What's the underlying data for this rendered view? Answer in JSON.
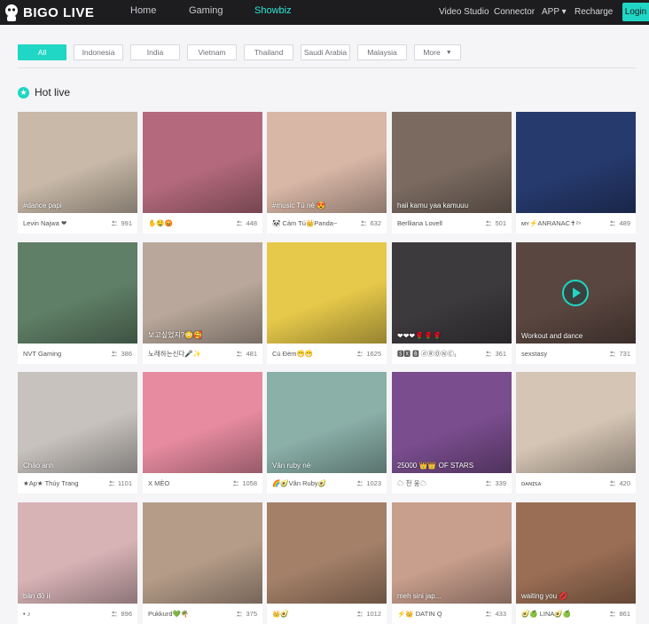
{
  "brand": {
    "name": "BIGO LIVE",
    "accent": "#20d6c4"
  },
  "nav": {
    "home": "Home",
    "gaming": "Gaming",
    "showbiz": "Showbiz",
    "video_studio": "Video Studio",
    "connector": "Connector",
    "app": "APP ▾",
    "recharge": "Recharge",
    "login": "Login"
  },
  "filters": [
    "All",
    "Indonesia",
    "India",
    "Vietnam",
    "Thailand",
    "Saudi Arabia",
    "Malaysia"
  ],
  "filters_more": "More",
  "section": {
    "title": "Hot live",
    "icon": "star-icon"
  },
  "cards": [
    {
      "label": "#dance papi",
      "name": "Levin Najwa ❤",
      "viewers": "991",
      "bg": "#c8b9a8"
    },
    {
      "label": "",
      "name": "✋🤤😡",
      "viewers": "448",
      "bg": "#b46a7c"
    },
    {
      "label": "#music Tú nè 😍",
      "name": "🐼 Cám Tú👑Panda~",
      "viewers": "632",
      "bg": "#d8b7a6"
    },
    {
      "label": "haii kamu yaa kamuuu",
      "name": "Berlliana Lovell",
      "viewers": "501",
      "bg": "#7a6a60"
    },
    {
      "label": "",
      "name": "ᴍʏ⚡ANRANAC✝⁲⁹",
      "viewers": "489",
      "bg": "#263a6e"
    },
    {
      "label": "",
      "name": "NVT Gaming",
      "viewers": "386",
      "bg": "#5f7f66"
    },
    {
      "label": "보고싶었지?😳🥰",
      "name": "노래하는신다🎤✨",
      "viewers": "481",
      "bg": "#b8a79a"
    },
    {
      "label": "",
      "name": "Cù Đèm😁😁",
      "viewers": "1625",
      "bg": "#e6c94a"
    },
    {
      "label": "❤❤❤🌹🌹🌹",
      "name": "🆂🆇 🅱 ⓓⓇⓄⓃⒸ₁",
      "viewers": "361",
      "bg": "#3d3a3e"
    },
    {
      "label": "Workout and dance",
      "name": "sexstasy",
      "viewers": "731",
      "bg": "#5a4640"
    },
    {
      "label": "Chào anh",
      "name": "★Ap★ Thúy Trang",
      "viewers": "1101",
      "bg": "#c7c2be"
    },
    {
      "label": "",
      "name": "X MÈO",
      "viewers": "1058",
      "bg": "#e78ba0"
    },
    {
      "label": "Vân ruby nè",
      "name": "🌈🥑Vân Ruby🥑",
      "viewers": "1023",
      "bg": "#8ab0a8"
    },
    {
      "label": "25000 👑👑 OF STARS",
      "name": "☁ 천 웅☁",
      "viewers": "339",
      "bg": "#7a4d8e"
    },
    {
      "label": "",
      "name": "ᴅᴀɴɪꜱᴀ",
      "viewers": "420",
      "bg": "#d5c5b4"
    },
    {
      "label": "bán đồ ii",
      "name": "̀• ♪",
      "viewers": "896",
      "bg": "#d8b3b6"
    },
    {
      "label": "",
      "name": "Pukkurd💚🌴",
      "viewers": "375",
      "bg": "#b59c88"
    },
    {
      "label": "",
      "name": "👑🥑",
      "viewers": "1012",
      "bg": "#a48068"
    },
    {
      "label": "meh sini jap...",
      "name": "⚡👑 DATIN Q",
      "viewers": "433",
      "bg": "#c89e8c"
    },
    {
      "label": "waiting you 💋",
      "name": "🥑🍏 LINA🥑🍏",
      "viewers": "861",
      "bg": "#9a6e54"
    }
  ]
}
